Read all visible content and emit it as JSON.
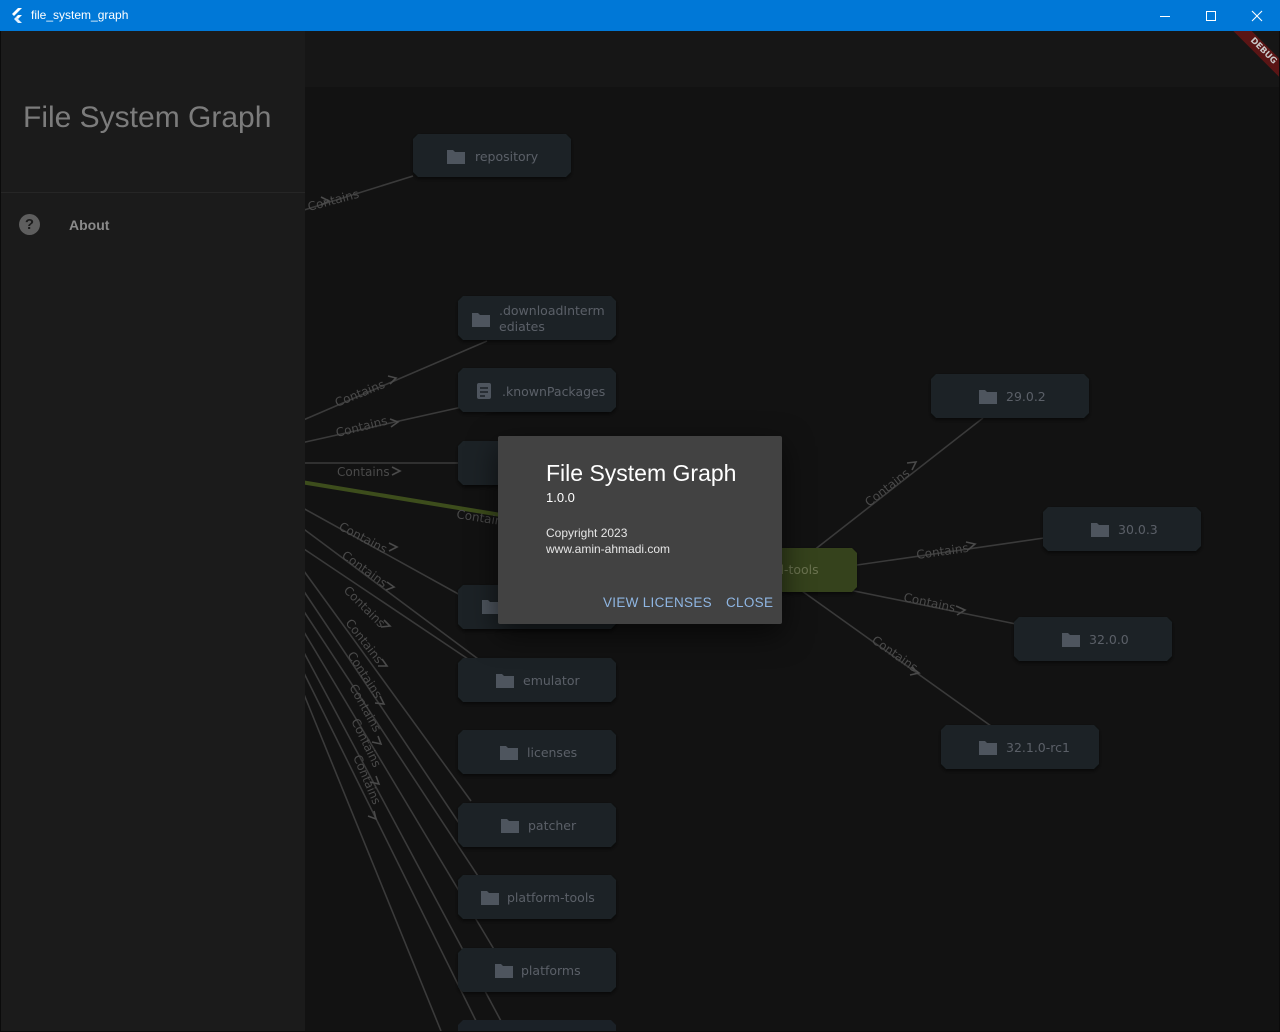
{
  "window": {
    "title": "file_system_graph"
  },
  "drawer": {
    "title": "File System Graph",
    "items": [
      {
        "label": "About",
        "icon": "help-circle-icon"
      }
    ]
  },
  "debug_banner": "DEBUG",
  "graph": {
    "edge_label": "Contains",
    "root_partial_label": "d-tools",
    "nodes": {
      "repository": "repository",
      "downloadIntermediates_1": ".downloadInterm",
      "downloadIntermediates_2": "ediates",
      "knownPackages": ".knownPackages",
      "emulator": "emulator",
      "licenses": "licenses",
      "patcher": "patcher",
      "platform_tools": "platform-tools",
      "platforms": "platforms",
      "v2902": "29.0.2",
      "v3003": "30.0.3",
      "v3200": "32.0.0",
      "v3210rc1": "32.1.0-rc1"
    }
  },
  "dialog": {
    "title": "File System Graph",
    "version": "1.0.0",
    "copyright": "Copyright 2023",
    "website": "www.amin-ahmadi.com",
    "view_licenses": "VIEW LICENSES",
    "close": "CLOSE"
  },
  "colors": {
    "titlebar": "#0078d7",
    "node_fill": "#1b2127",
    "selected_node": "#34421c",
    "dialog_bg": "#424242",
    "dialog_button": "#8fb6e3"
  }
}
